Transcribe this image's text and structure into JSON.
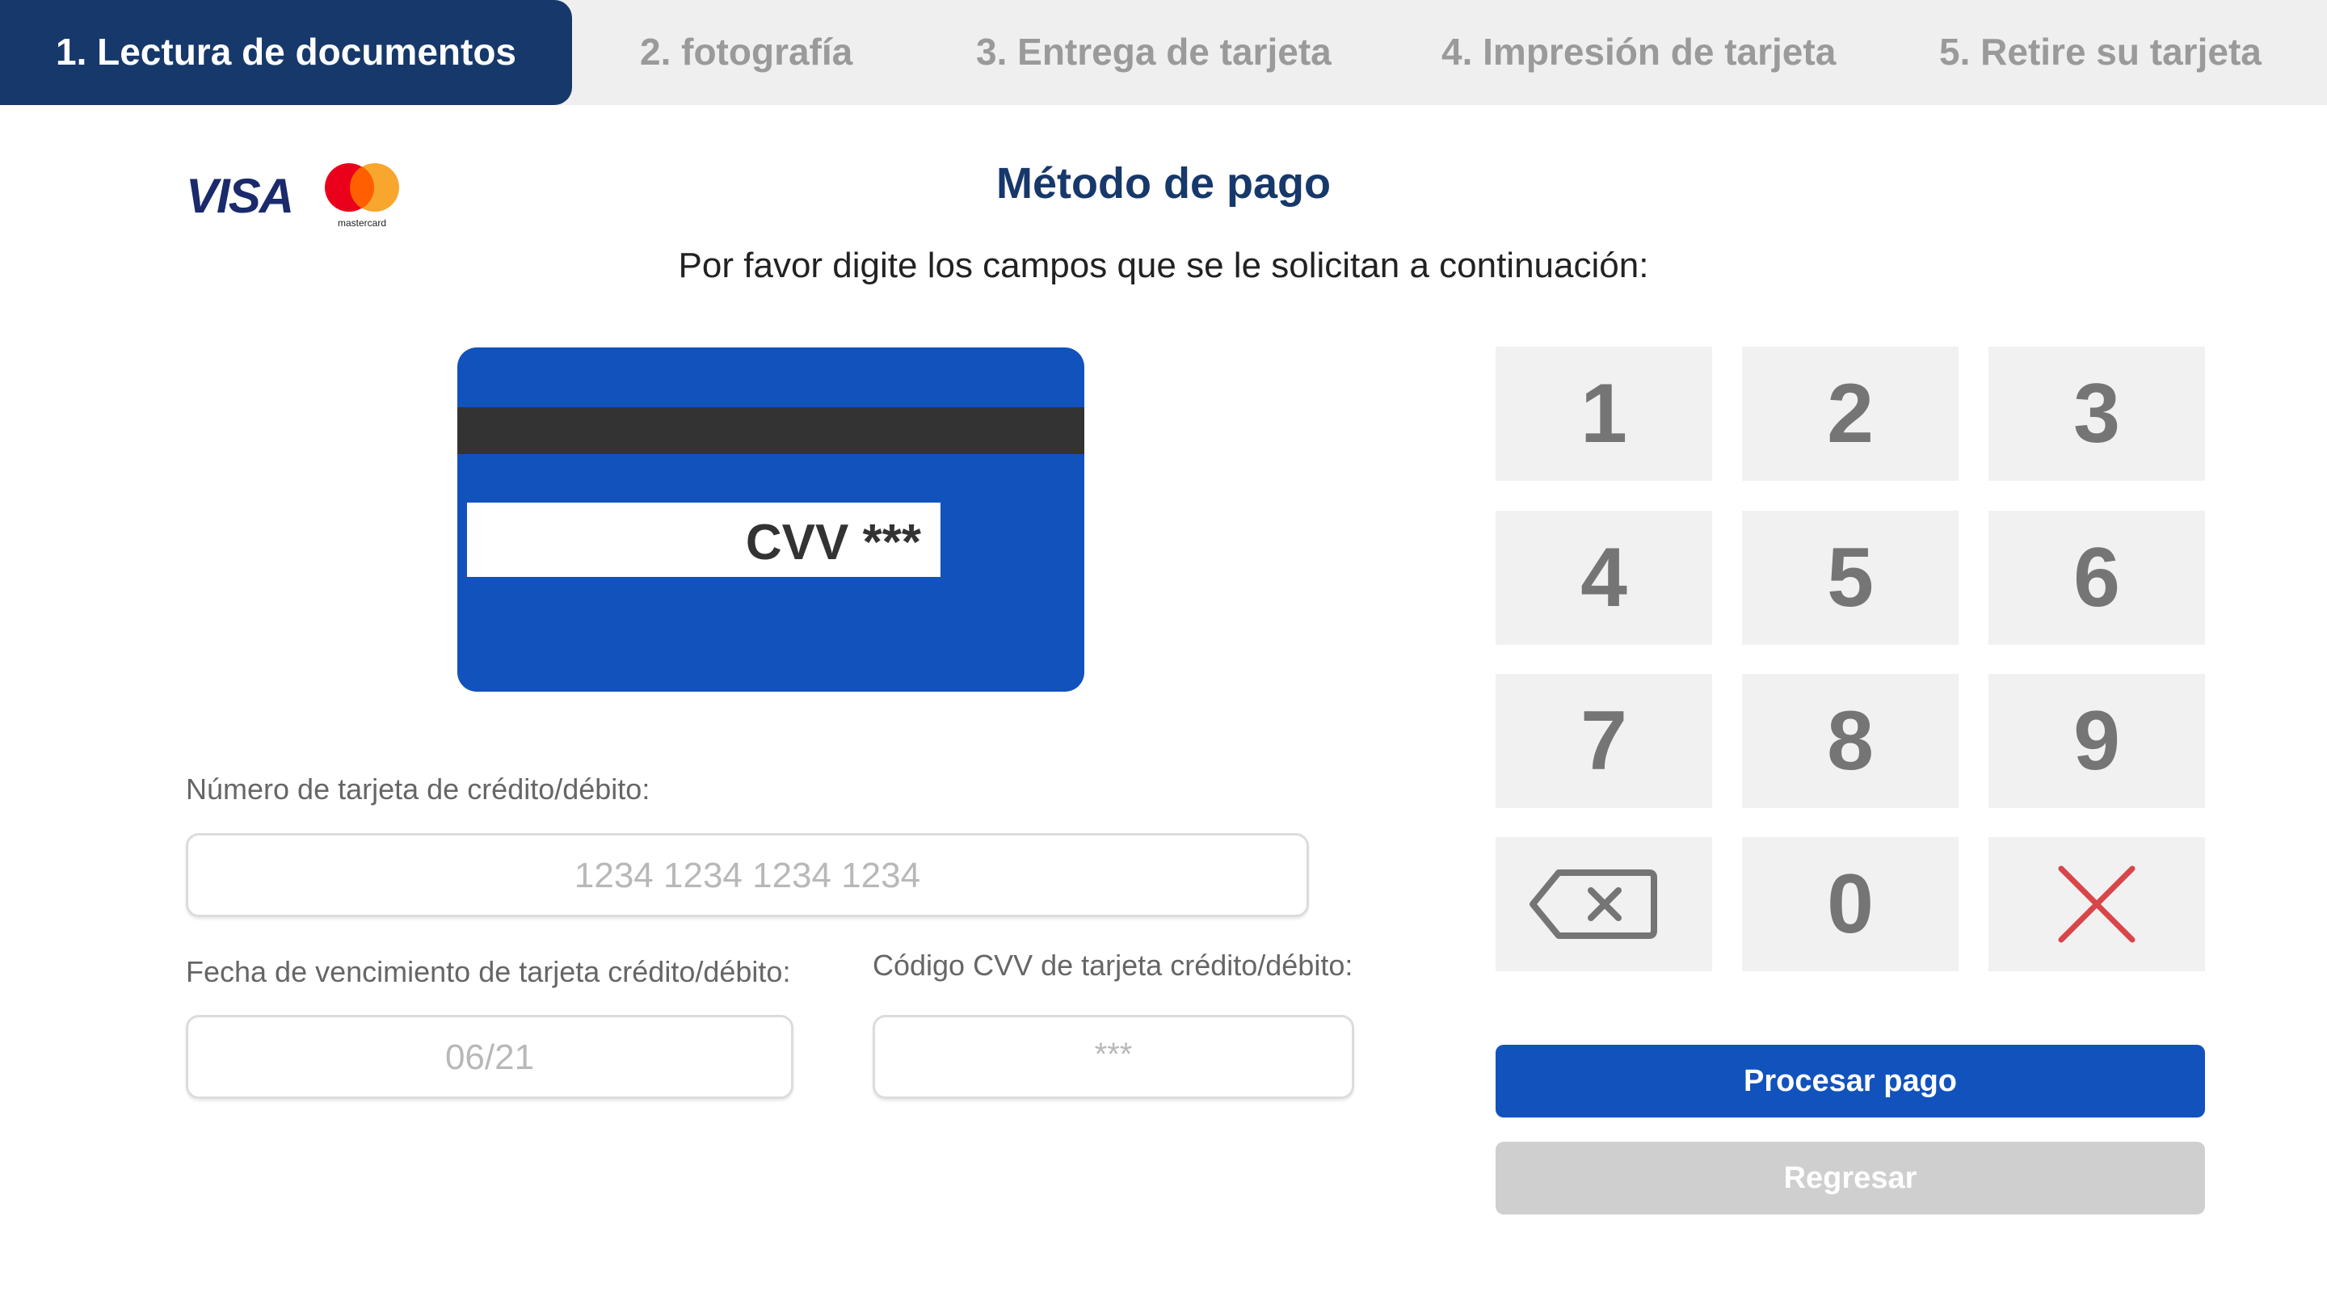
{
  "steps": [
    {
      "label": "1. Lectura de documentos",
      "active": true
    },
    {
      "label": "2. fotografía",
      "active": false
    },
    {
      "label": "3. Entrega de tarjeta",
      "active": false
    },
    {
      "label": "4. Impresión de tarjeta",
      "active": false
    },
    {
      "label": "5. Retire su tarjeta",
      "active": false
    }
  ],
  "logos": {
    "visa": "VISA",
    "mastercard": "mastercard"
  },
  "header": {
    "title": "Método de pago",
    "subtitle": "Por favor digite los campos que se le solicitan a continuación:"
  },
  "card_illustration": {
    "cvv_text": "CVV ***"
  },
  "form": {
    "card_number": {
      "label": "Número de tarjeta de crédito/débito:",
      "placeholder": "1234 1234 1234 1234"
    },
    "expiry": {
      "label": "Fecha de vencimiento de tarjeta crédito/débito:",
      "placeholder": "06/21"
    },
    "cvv": {
      "label": "Código CVV de tarjeta crédito/débito:",
      "placeholder": "***"
    }
  },
  "keypad": {
    "keys": [
      "1",
      "2",
      "3",
      "4",
      "5",
      "6",
      "7",
      "8",
      "9"
    ],
    "zero": "0",
    "backspace_icon": "backspace-icon",
    "clear_icon": "close-icon"
  },
  "actions": {
    "process": "Procesar pago",
    "back": "Regresar"
  },
  "colors": {
    "primary": "#1252bd",
    "navy": "#17386a",
    "key_bg": "#f1f1f1",
    "clear_red": "#d8464a"
  }
}
